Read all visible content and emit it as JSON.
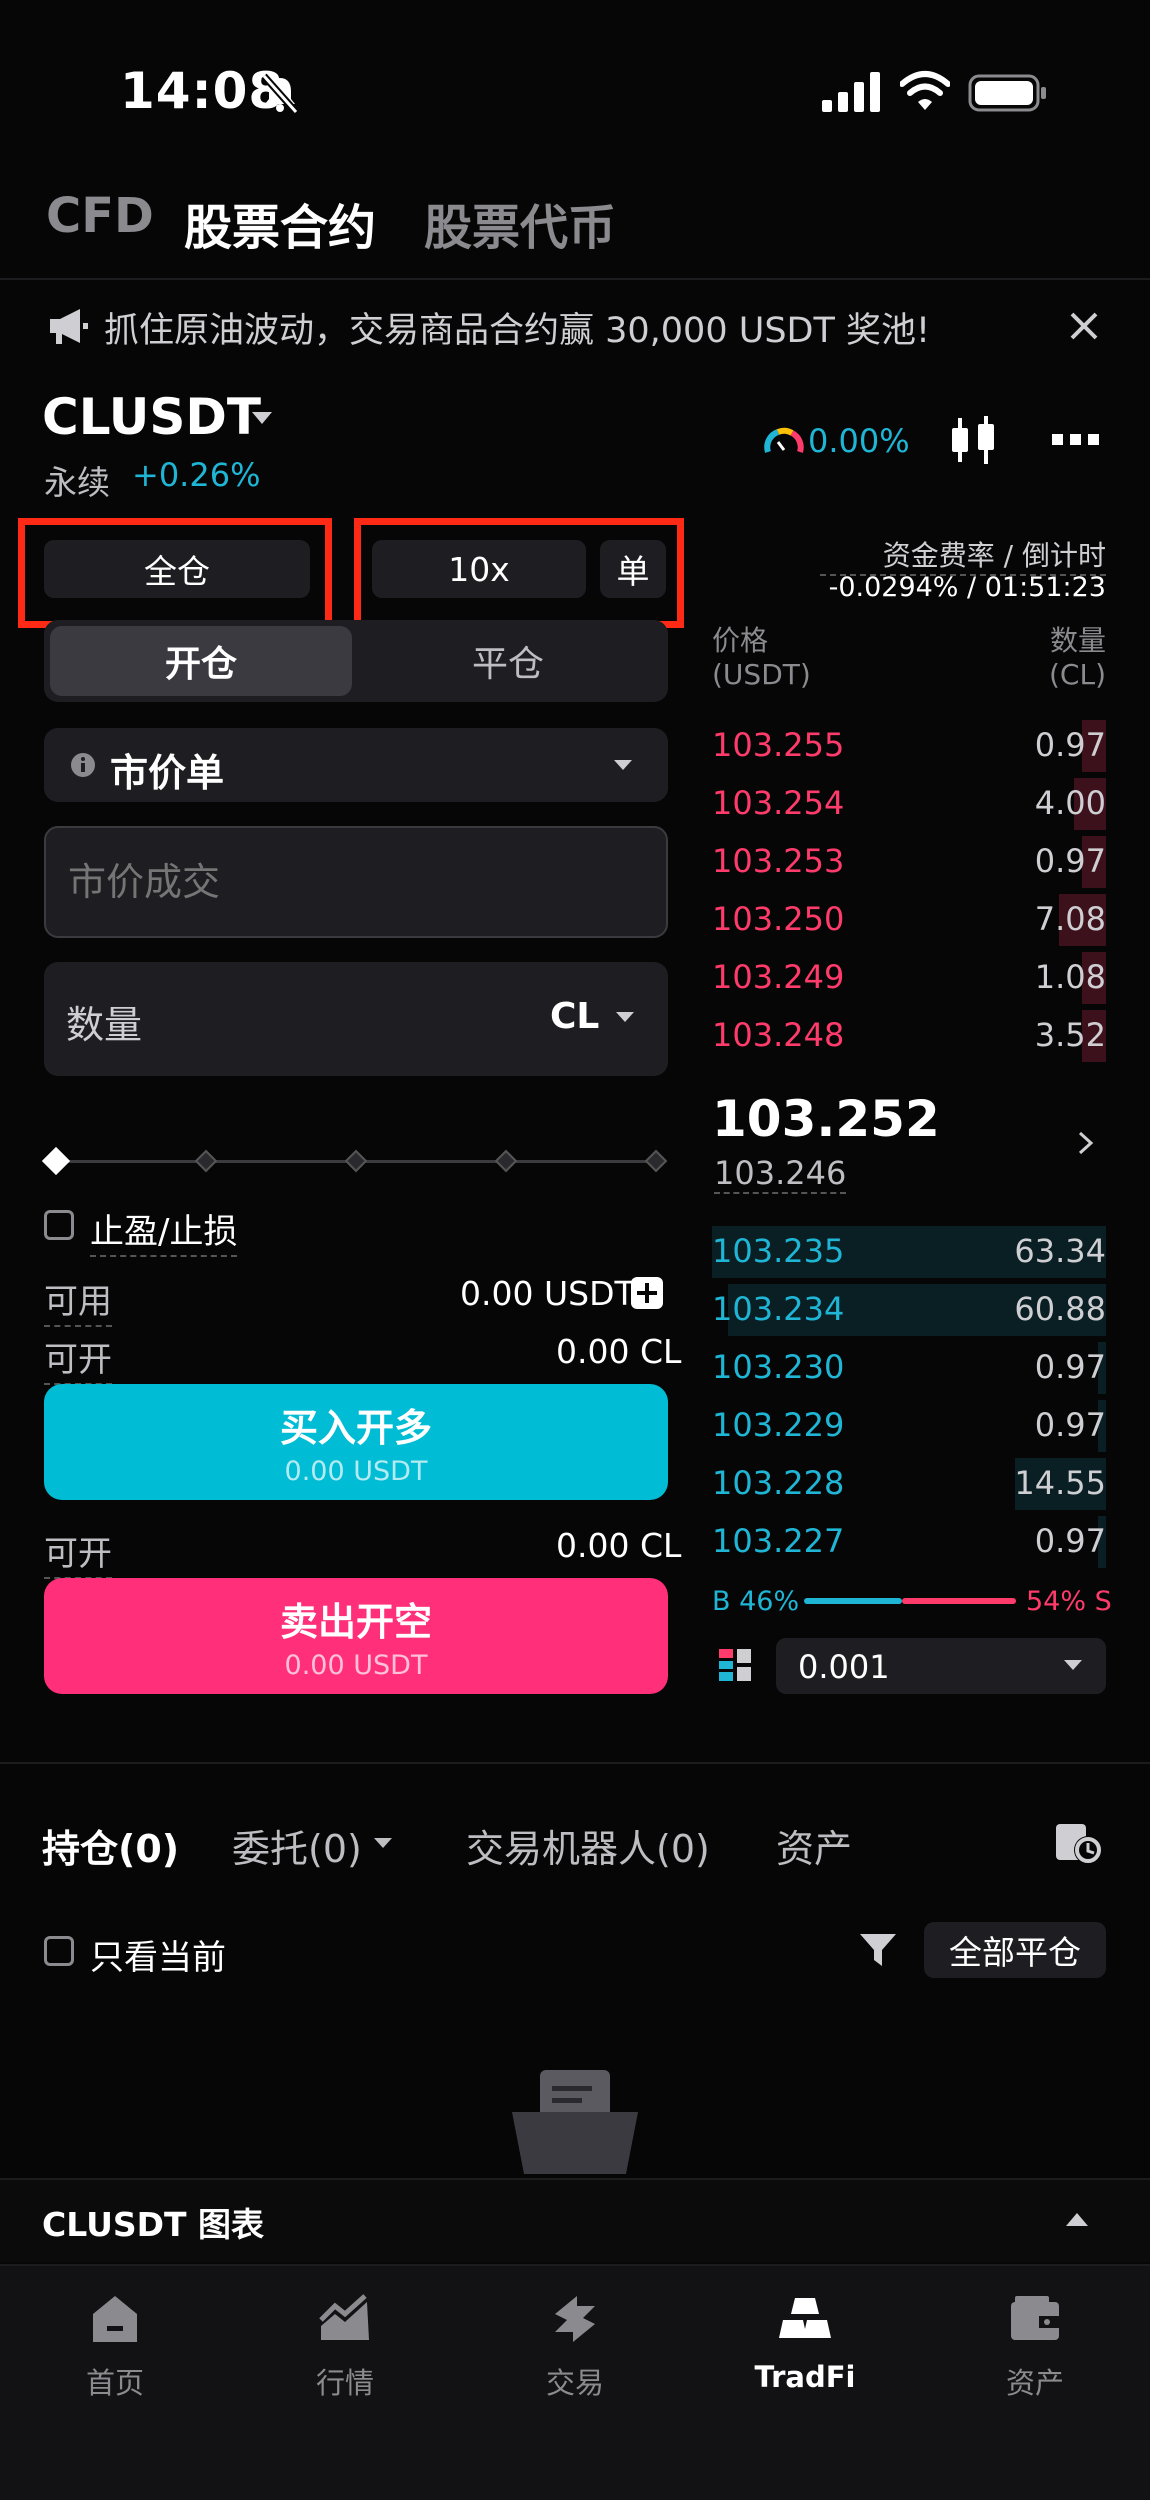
{
  "status_bar": {
    "time": "14:08"
  },
  "top_tabs": [
    "CFD",
    "股票合约",
    "股票代币"
  ],
  "announcement": {
    "text": "抓住原油波动，交易商品合约赢 30,000 USDT 奖池!"
  },
  "header": {
    "symbol": "CLUSDT",
    "contract_type": "永续",
    "change": "+0.26%",
    "rate": "0.00%"
  },
  "selectors": {
    "margin_mode": "全仓",
    "leverage": "10x",
    "position_mode": "单"
  },
  "mode_tabs": {
    "open": "开仓",
    "close": "平仓"
  },
  "order_form": {
    "order_type": "市价单",
    "price_placeholder": "市价成交",
    "quantity_label": "数量",
    "quantity_unit": "CL",
    "tpsl_label": "止盈/止损",
    "available_label": "可用",
    "available_value": "0.00 USDT",
    "can_open_label": "可开",
    "buy_can_open_value": "0.00 CL",
    "sell_can_open_value": "0.00 CL",
    "buy_label": "买入开多",
    "buy_sub": "0.00 USDT",
    "sell_label": "卖出开空",
    "sell_sub": "0.00 USDT",
    "slider_level": 0
  },
  "order_book": {
    "funding_label": "资金费率 / 倒计时",
    "funding_value": "-0.0294% / 01:51:23",
    "price_header": "价格",
    "price_unit": "(USDT)",
    "qty_header": "数量",
    "qty_unit": "(CL)",
    "asks": [
      {
        "price": "103.255",
        "qty": "0.97",
        "depth": 0.06
      },
      {
        "price": "103.254",
        "qty": "4.00",
        "depth": 0.08
      },
      {
        "price": "103.253",
        "qty": "0.97",
        "depth": 0.06
      },
      {
        "price": "103.250",
        "qty": "7.08",
        "depth": 0.12
      },
      {
        "price": "103.249",
        "qty": "1.08",
        "depth": 0.06
      },
      {
        "price": "103.248",
        "qty": "3.52",
        "depth": 0.06
      }
    ],
    "last_price": "103.252",
    "mark_price": "103.246",
    "bids": [
      {
        "price": "103.235",
        "qty": "63.34",
        "depth": 1.0
      },
      {
        "price": "103.234",
        "qty": "60.88",
        "depth": 0.96
      },
      {
        "price": "103.230",
        "qty": "0.97",
        "depth": 0.02
      },
      {
        "price": "103.229",
        "qty": "0.97",
        "depth": 0.02
      },
      {
        "price": "103.228",
        "qty": "14.55",
        "depth": 0.23
      },
      {
        "price": "103.227",
        "qty": "0.97",
        "depth": 0.02
      }
    ],
    "buy_ratio": "B 46%",
    "sell_ratio": "54% S",
    "buy_ratio_value": 0.46,
    "depth_step": "0.001"
  },
  "positions": {
    "tabs": [
      "持仓(0)",
      "委托(0)",
      "交易机器人(0)",
      "资产"
    ],
    "only_current_label": "只看当前",
    "close_all_label": "全部平仓"
  },
  "chart_bar": {
    "label": "CLUSDT 图表"
  },
  "bottom_nav": [
    "首页",
    "行情",
    "交易",
    "TradFi",
    "资产"
  ],
  "colors": {
    "buy": "#00bcd4",
    "sell": "#ff2f79",
    "accent_blue": "#1fb6d6",
    "accent_red": "#ff3b6b"
  }
}
